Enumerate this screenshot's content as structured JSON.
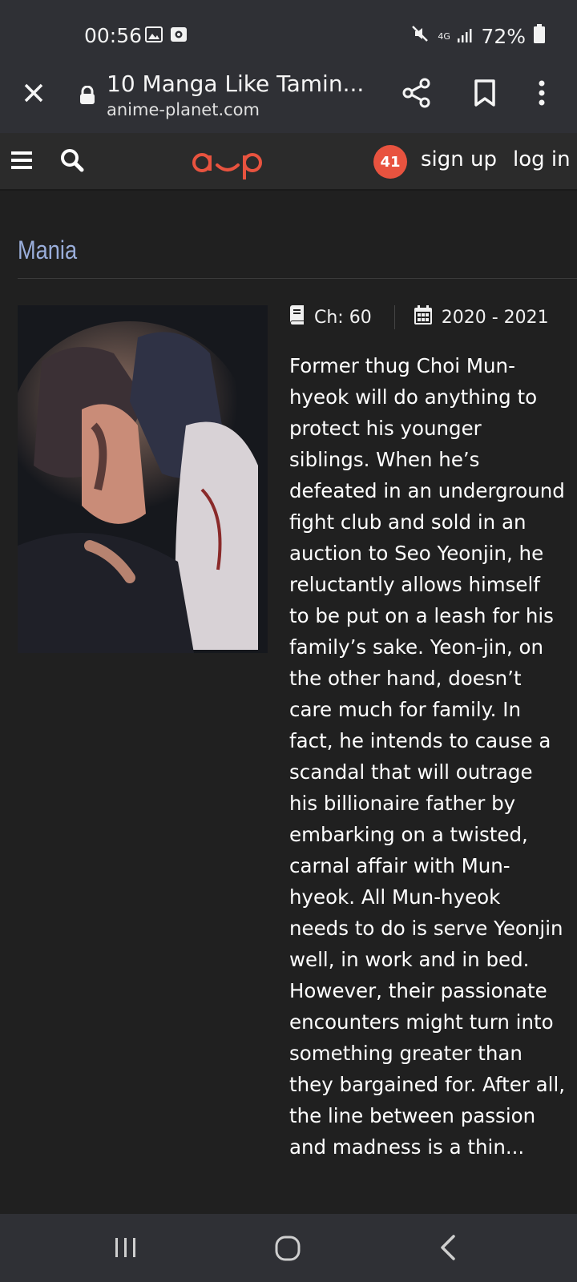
{
  "status_bar": {
    "time": "00:56",
    "network": "4G",
    "battery": "72%"
  },
  "browser": {
    "title": "10 Manga Like Tamin...",
    "url": "anime-planet.com"
  },
  "site_nav": {
    "logo_alt": "a‿p",
    "notification_count": "41",
    "sign_up": "sign up",
    "log_in": "log in"
  },
  "section": {
    "title": "Mania"
  },
  "manga": {
    "chapters": "Ch: 60",
    "years": "2020 - 2021",
    "synopsis": "Former thug Choi Mun-hyeok will do anything to protect his younger siblings. When he’s defeated in an underground fight club and sold in an auction to Seo Yeonjin, he reluctantly allows himself to be put on a leash for his family’s sake. Yeon-jin, on the other hand, doesn’t care much for family. In fact, he intends to cause a scandal that will outrage his billionaire father by embarking on a twisted, carnal affair with Mun-hyeok. All Mun-hyeok needs to do is serve Yeonjin well, in work and in bed. However, their passionate encounters might turn into something greater than they bargained for. After all, the line between passion and madness is a thin..."
  },
  "colors": {
    "brand": "#e8533f",
    "section_title": "#9aaedb",
    "background": "#202020"
  }
}
